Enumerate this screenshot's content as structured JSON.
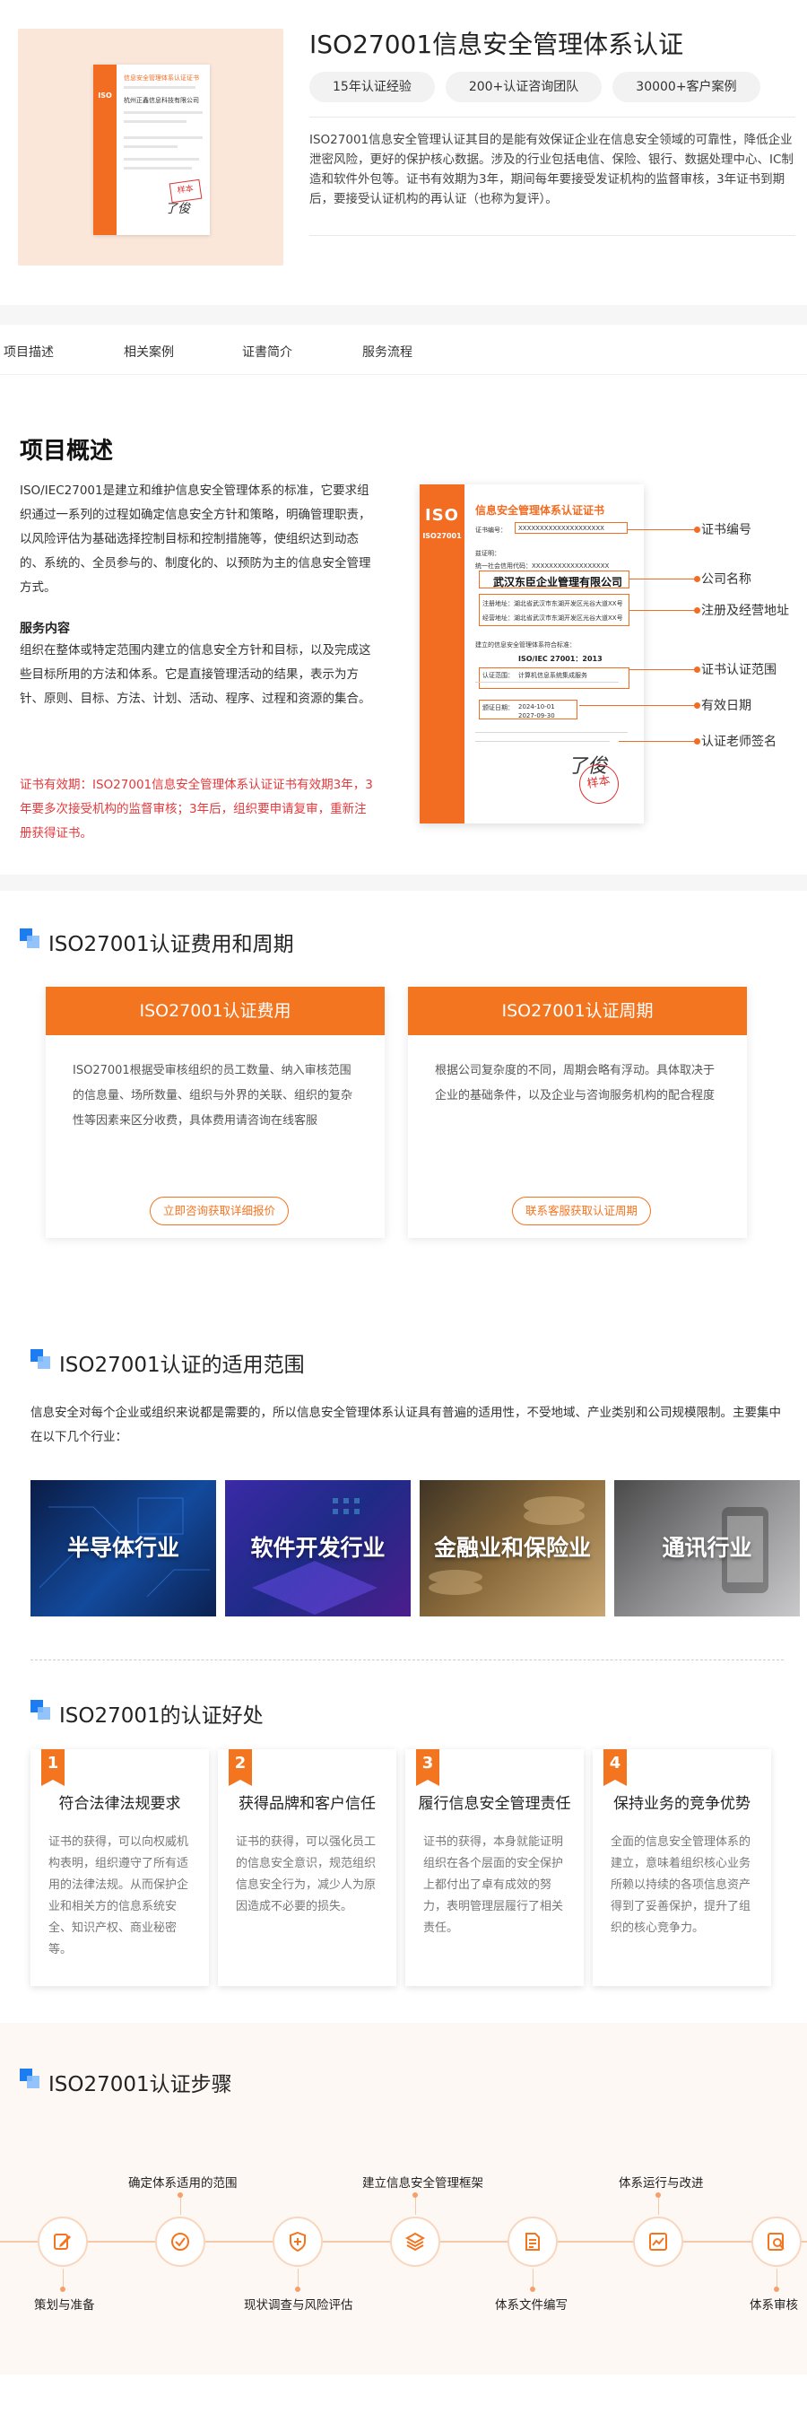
{
  "hero": {
    "title": "ISO27001信息安全管理体系认证",
    "tags": [
      "15年认证经验",
      "200+认证咨询团队",
      "30000+客户案例"
    ],
    "desc": "ISO27001信息安全管理认证其目的是能有效保证企业在信息安全领域的可靠性，降低企业泄密风险，更好的保护核心数据。涉及的行业包括电信、保险、银行、数据处理中心、IC制造和软件外包等。证书有效期为3年，期间每年要接受发证机构的监督审核，3年证书到期后，要接受认证机构的再认证（也称为复评）。",
    "mini_cert": {
      "title": "信息安全管理体系认证证书",
      "company": "杭州正鑫信息科技有限公司",
      "stamp": "样本"
    }
  },
  "tabs": [
    "项目描述",
    "相关案例",
    "证書简介",
    "服务流程"
  ],
  "overview": {
    "title": "项目概述",
    "p1": "ISO/IEC27001是建立和维护信息安全管理体系的标准，它要求组织通过一系列的过程如确定信息安全方针和策略，明确管理职责，以风险评估为基础选择控制目标和控制措施等，使组织达到动态的、系统的、全员参与的、制度化的、以预防为主的信息安全管理方式。",
    "h2": "服务内容",
    "p2": "组织在整体或特定范围内建立的信息安全方针和目标，以及完成这些目标所用的方法和体系。它是直接管理活动的结果，表示为方针、原则、目标、方法、计划、活动、程序、过程和资源的集合。",
    "red": "证书有效期：ISO27001信息安全管理体系认证证书有效期3年，3年要多次接受机构的监督审核；3年后，组织要申请复审，重新注册获得证书。"
  },
  "cert": {
    "iso": "ISO",
    "iso_code": "ISO27001",
    "title": "信息安全管理体系认证证书",
    "no_label": "证书编号：",
    "no": "XXXXXXXXXXXXXXXXXXXX",
    "holder_label": "兹证明：",
    "unified_code": "统一社会信用代码：XXXXXXXXXXXXXXXXXX",
    "company": "武汉东臣企业管理有限公司",
    "reg_addr": "注册地址：湖北省武汉市东湖开发区光谷大道XX号",
    "biz_addr": "经营地址：湖北省武汉市东湖开发区光谷大道XX号",
    "std_line": "建立的信息安全管理体系符合标准：",
    "std": "ISO/IEC 27001：2013",
    "scope_label": "认证范围：",
    "scope": "计算机信息系统集成服务",
    "valid_label": "颁证日期：",
    "valid_from": "2024-10-01",
    "valid_to": "2027-09-30",
    "stamp": "样本",
    "sig": "了俊",
    "labels": [
      "证书编号",
      "公司名称",
      "注册及经营地址",
      "证书认证范围",
      "有效日期",
      "认证老师签名"
    ]
  },
  "fees": {
    "section_title": "ISO27001认证费用和周期",
    "cards": [
      {
        "title": "ISO27001认证费用",
        "body": "ISO27001根据受审核组织的员工数量、纳入审核范围的信息量、场所数量、组织与外界的关联、组织的复杂性等因素来区分收费，具体费用请咨询在线客服",
        "button": "立即咨询获取详细报价"
      },
      {
        "title": "ISO27001认证周期",
        "body": "根据公司复杂度的不同，周期会略有浮动。具体取决于企业的基础条件，以及企业与咨询服务机构的配合程度",
        "button": "联系客服获取认证周期"
      }
    ]
  },
  "scope": {
    "section_title": "ISO27001认证的适用范围",
    "desc": "信息安全对每个企业或组织来说都是需要的，所以信息安全管理体系认证具有普遍的适用性，不受地域、产业类别和公司规模限制。主要集中在以下几个行业：",
    "industries": [
      "半导体行业",
      "软件开发行业",
      "金融业和保险业",
      "通讯行业"
    ],
    "colors": [
      "#0f2d6b",
      "#2b2f9a",
      "#8a6a3b",
      "#6f6f70"
    ]
  },
  "benefits": {
    "section_title": "ISO27001的认证好处",
    "items": [
      {
        "num": "1",
        "title": "符合法律法规要求",
        "desc": "证书的获得，可以向权威机构表明，组织遵守了所有适用的法律法规。从而保护企业和相关方的信息系统安全、知识产权、商业秘密等。"
      },
      {
        "num": "2",
        "title": "获得品牌和客户信任",
        "desc": "证书的获得，可以强化员工的信息安全意识，规范组织信息安全行为，减少人为原因造成不必要的损失。"
      },
      {
        "num": "3",
        "title": "履行信息安全管理责任",
        "desc": "证书的获得，本身就能证明组织在各个层面的安全保护上都付出了卓有成效的努力，表明管理层履行了相关责任。"
      },
      {
        "num": "4",
        "title": "保持业务的竞争优势",
        "desc": "全面的信息安全管理体系的建立，意味着组织核心业务所赖以持续的各项信息资产得到了妥善保护，提升了组织的核心竞争力。"
      }
    ]
  },
  "steps": {
    "section_title": "ISO27001认证步骤",
    "items": [
      {
        "label": "策划与准备",
        "icon": "edit-icon"
      },
      {
        "label": "确定体系适用的范围",
        "icon": "check-circle-icon"
      },
      {
        "label": "现状调查与风险评估",
        "icon": "shield-icon"
      },
      {
        "label": "建立信息安全管理框架",
        "icon": "layers-icon"
      },
      {
        "label": "体系文件编写",
        "icon": "document-icon"
      },
      {
        "label": "体系运行与改进",
        "icon": "chart-icon"
      },
      {
        "label": "体系审核",
        "icon": "search-icon"
      }
    ]
  }
}
